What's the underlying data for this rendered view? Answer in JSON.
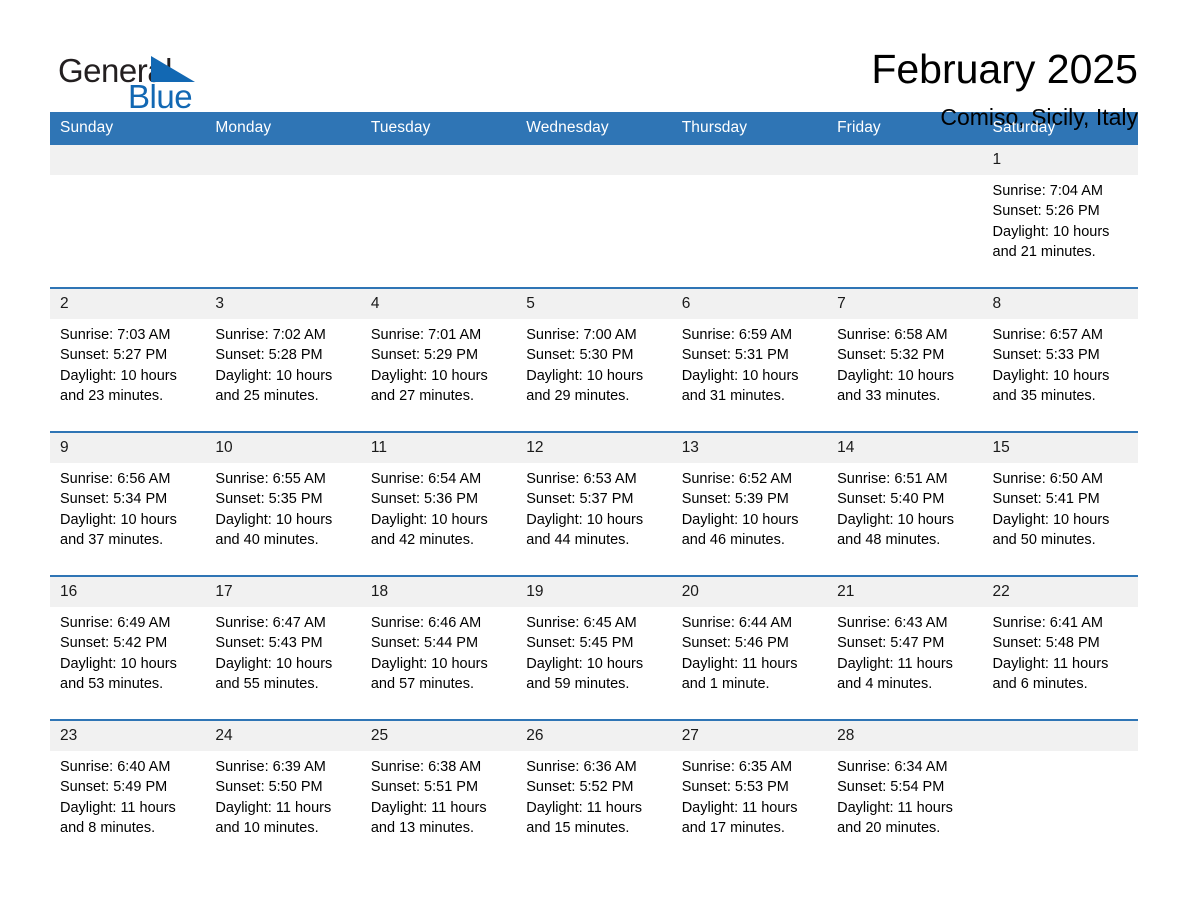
{
  "brand": {
    "word_one": "General",
    "word_two": "Blue",
    "flag_icon": "triangle-flag-icon",
    "blue": "#1268b3"
  },
  "header": {
    "title": "February 2025",
    "location": "Comiso, Sicily, Italy"
  },
  "calendar": {
    "weekday_headers": [
      "Sunday",
      "Monday",
      "Tuesday",
      "Wednesday",
      "Thursday",
      "Friday",
      "Saturday"
    ],
    "header_bg": "#2f75b5",
    "daynum_bg": "#f1f1f1",
    "weeks": [
      {
        "days": [
          {
            "num": "",
            "detail": ""
          },
          {
            "num": "",
            "detail": ""
          },
          {
            "num": "",
            "detail": ""
          },
          {
            "num": "",
            "detail": ""
          },
          {
            "num": "",
            "detail": ""
          },
          {
            "num": "",
            "detail": ""
          },
          {
            "num": "1",
            "detail": "Sunrise: 7:04 AM\nSunset: 5:26 PM\nDaylight: 10 hours\nand 21 minutes."
          }
        ]
      },
      {
        "days": [
          {
            "num": "2",
            "detail": "Sunrise: 7:03 AM\nSunset: 5:27 PM\nDaylight: 10 hours\nand 23 minutes."
          },
          {
            "num": "3",
            "detail": "Sunrise: 7:02 AM\nSunset: 5:28 PM\nDaylight: 10 hours\nand 25 minutes."
          },
          {
            "num": "4",
            "detail": "Sunrise: 7:01 AM\nSunset: 5:29 PM\nDaylight: 10 hours\nand 27 minutes."
          },
          {
            "num": "5",
            "detail": "Sunrise: 7:00 AM\nSunset: 5:30 PM\nDaylight: 10 hours\nand 29 minutes."
          },
          {
            "num": "6",
            "detail": "Sunrise: 6:59 AM\nSunset: 5:31 PM\nDaylight: 10 hours\nand 31 minutes."
          },
          {
            "num": "7",
            "detail": "Sunrise: 6:58 AM\nSunset: 5:32 PM\nDaylight: 10 hours\nand 33 minutes."
          },
          {
            "num": "8",
            "detail": "Sunrise: 6:57 AM\nSunset: 5:33 PM\nDaylight: 10 hours\nand 35 minutes."
          }
        ]
      },
      {
        "days": [
          {
            "num": "9",
            "detail": "Sunrise: 6:56 AM\nSunset: 5:34 PM\nDaylight: 10 hours\nand 37 minutes."
          },
          {
            "num": "10",
            "detail": "Sunrise: 6:55 AM\nSunset: 5:35 PM\nDaylight: 10 hours\nand 40 minutes."
          },
          {
            "num": "11",
            "detail": "Sunrise: 6:54 AM\nSunset: 5:36 PM\nDaylight: 10 hours\nand 42 minutes."
          },
          {
            "num": "12",
            "detail": "Sunrise: 6:53 AM\nSunset: 5:37 PM\nDaylight: 10 hours\nand 44 minutes."
          },
          {
            "num": "13",
            "detail": "Sunrise: 6:52 AM\nSunset: 5:39 PM\nDaylight: 10 hours\nand 46 minutes."
          },
          {
            "num": "14",
            "detail": "Sunrise: 6:51 AM\nSunset: 5:40 PM\nDaylight: 10 hours\nand 48 minutes."
          },
          {
            "num": "15",
            "detail": "Sunrise: 6:50 AM\nSunset: 5:41 PM\nDaylight: 10 hours\nand 50 minutes."
          }
        ]
      },
      {
        "days": [
          {
            "num": "16",
            "detail": "Sunrise: 6:49 AM\nSunset: 5:42 PM\nDaylight: 10 hours\nand 53 minutes."
          },
          {
            "num": "17",
            "detail": "Sunrise: 6:47 AM\nSunset: 5:43 PM\nDaylight: 10 hours\nand 55 minutes."
          },
          {
            "num": "18",
            "detail": "Sunrise: 6:46 AM\nSunset: 5:44 PM\nDaylight: 10 hours\nand 57 minutes."
          },
          {
            "num": "19",
            "detail": "Sunrise: 6:45 AM\nSunset: 5:45 PM\nDaylight: 10 hours\nand 59 minutes."
          },
          {
            "num": "20",
            "detail": "Sunrise: 6:44 AM\nSunset: 5:46 PM\nDaylight: 11 hours\nand 1 minute."
          },
          {
            "num": "21",
            "detail": "Sunrise: 6:43 AM\nSunset: 5:47 PM\nDaylight: 11 hours\nand 4 minutes."
          },
          {
            "num": "22",
            "detail": "Sunrise: 6:41 AM\nSunset: 5:48 PM\nDaylight: 11 hours\nand 6 minutes."
          }
        ]
      },
      {
        "days": [
          {
            "num": "23",
            "detail": "Sunrise: 6:40 AM\nSunset: 5:49 PM\nDaylight: 11 hours\nand 8 minutes."
          },
          {
            "num": "24",
            "detail": "Sunrise: 6:39 AM\nSunset: 5:50 PM\nDaylight: 11 hours\nand 10 minutes."
          },
          {
            "num": "25",
            "detail": "Sunrise: 6:38 AM\nSunset: 5:51 PM\nDaylight: 11 hours\nand 13 minutes."
          },
          {
            "num": "26",
            "detail": "Sunrise: 6:36 AM\nSunset: 5:52 PM\nDaylight: 11 hours\nand 15 minutes."
          },
          {
            "num": "27",
            "detail": "Sunrise: 6:35 AM\nSunset: 5:53 PM\nDaylight: 11 hours\nand 17 minutes."
          },
          {
            "num": "28",
            "detail": "Sunrise: 6:34 AM\nSunset: 5:54 PM\nDaylight: 11 hours\nand 20 minutes."
          },
          {
            "num": "",
            "detail": ""
          }
        ]
      }
    ]
  }
}
